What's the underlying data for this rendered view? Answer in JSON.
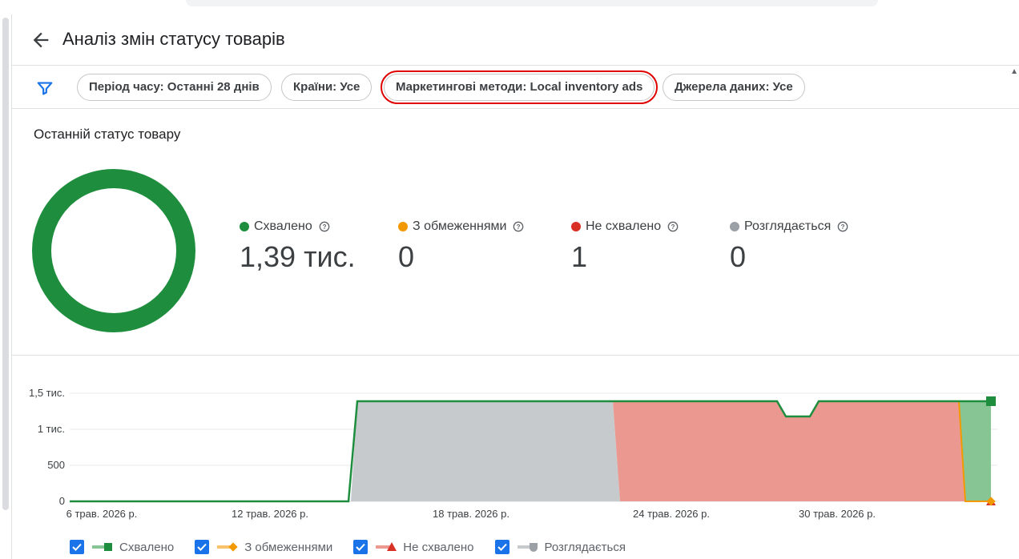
{
  "page": {
    "title": "Аналіз змін статусу товарів"
  },
  "filters": {
    "chips": [
      {
        "label": "Період часу: Останні 28 днів"
      },
      {
        "label": "Країни: Усе"
      },
      {
        "label": "Маркетингові методи: Local inventory ads"
      },
      {
        "label": "Джерела даних: Усе"
      }
    ]
  },
  "summary": {
    "title": "Останній статус товару",
    "stats": [
      {
        "label": "Схвалено",
        "value": "1,39 тис.",
        "color": "#1e8e3e"
      },
      {
        "label": "З обмеженнями",
        "value": "0",
        "color": "#f29900"
      },
      {
        "label": "Не схвалено",
        "value": "1",
        "color": "#d93025"
      },
      {
        "label": "Розглядається",
        "value": "0",
        "color": "#9aa0a6"
      }
    ]
  },
  "chart_data": {
    "type": "area",
    "y_ticks": [
      "1,5 тис.",
      "1 тис.",
      "500",
      "0"
    ],
    "ylim": [
      0,
      1500
    ],
    "x_ticks": [
      "6 трав. 2026 р.",
      "12 трав. 2026 р.",
      "18 трав. 2026 р.",
      "24 трав. 2026 р.",
      "30 трав. 2026 р."
    ],
    "grid": true,
    "series": [
      {
        "name": "Схвалено",
        "color": "#1e8e3e"
      },
      {
        "name": "З обмеженнями",
        "color": "#f29900"
      },
      {
        "name": "Не схвалено",
        "color": "#d93025"
      },
      {
        "name": "Розглядається",
        "color": "#9aa0a6"
      }
    ],
    "total_line": [
      {
        "day": "6 трав.",
        "y": 0
      },
      {
        "day": "14 трав.",
        "y": 0
      },
      {
        "day": "15 трав.",
        "y": 1390
      },
      {
        "day": "30 трав.",
        "y": 1390
      },
      {
        "day": "31 трав.",
        "y": 1190
      },
      {
        "day": "1 черв.",
        "y": 1390
      },
      {
        "day": "4 черв.",
        "y": 1390
      }
    ]
  },
  "legend": {
    "items": [
      {
        "label": "Схвалено"
      },
      {
        "label": "З обмеженнями"
      },
      {
        "label": "Не схвалено"
      },
      {
        "label": "Розглядається"
      }
    ]
  }
}
